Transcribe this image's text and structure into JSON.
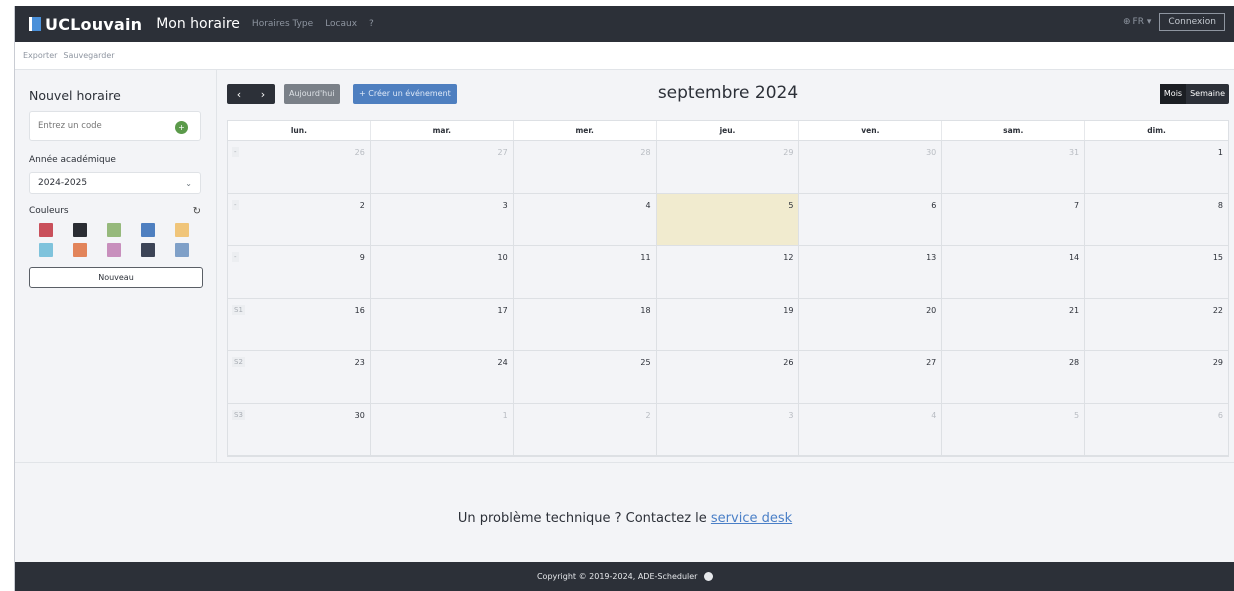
{
  "navbar": {
    "brand": "UCLouvain",
    "main_link": "Mon horaire",
    "links": [
      "Horaires Type",
      "Locaux",
      "?"
    ],
    "lang": "FR",
    "login_button": "Connexion"
  },
  "subbar": {
    "items": [
      "Exporter",
      "Sauvegarder"
    ]
  },
  "sidebar": {
    "title": "Nouvel horaire",
    "code_placeholder": "Entrez un code",
    "code_add_icon": "+",
    "year_label": "Année académique",
    "year_value": "2024-2025",
    "colors_label": "Couleurs",
    "colors": [
      "#c9505b",
      "#2a2d33",
      "#96b97c",
      "#4e7fc0",
      "#f0c57a",
      "#7fc3dc",
      "#e2845a",
      "#c88fbd",
      "#3c4456",
      "#7fa0c8"
    ],
    "new_button": "Nouveau"
  },
  "toolbar": {
    "prev_icon": "‹",
    "next_icon": "›",
    "today_button": "Aujourd'hui",
    "create_button": "+ Créer un événement",
    "month_title": "septembre 2024",
    "view_month": "Mois",
    "view_week": "Semaine"
  },
  "calendar": {
    "weekdays": [
      "lun.",
      "mar.",
      "mer.",
      "jeu.",
      "ven.",
      "sam.",
      "dim."
    ],
    "weeks": [
      {
        "week": "-",
        "days": [
          {
            "num": "26",
            "other": true
          },
          {
            "num": "27",
            "other": true
          },
          {
            "num": "28",
            "other": true
          },
          {
            "num": "29",
            "other": true
          },
          {
            "num": "30",
            "other": true
          },
          {
            "num": "31",
            "other": true
          },
          {
            "num": "1",
            "other": false
          }
        ]
      },
      {
        "week": "-",
        "days": [
          {
            "num": "2",
            "other": false
          },
          {
            "num": "3",
            "other": false
          },
          {
            "num": "4",
            "other": false
          },
          {
            "num": "5",
            "other": false,
            "today": true
          },
          {
            "num": "6",
            "other": false
          },
          {
            "num": "7",
            "other": false
          },
          {
            "num": "8",
            "other": false
          }
        ]
      },
      {
        "week": "-",
        "days": [
          {
            "num": "9",
            "other": false
          },
          {
            "num": "10",
            "other": false
          },
          {
            "num": "11",
            "other": false
          },
          {
            "num": "12",
            "other": false
          },
          {
            "num": "13",
            "other": false
          },
          {
            "num": "14",
            "other": false
          },
          {
            "num": "15",
            "other": false
          }
        ]
      },
      {
        "week": "S1",
        "days": [
          {
            "num": "16",
            "other": false
          },
          {
            "num": "17",
            "other": false
          },
          {
            "num": "18",
            "other": false
          },
          {
            "num": "19",
            "other": false
          },
          {
            "num": "20",
            "other": false
          },
          {
            "num": "21",
            "other": false
          },
          {
            "num": "22",
            "other": false
          }
        ]
      },
      {
        "week": "S2",
        "days": [
          {
            "num": "23",
            "other": false
          },
          {
            "num": "24",
            "other": false
          },
          {
            "num": "25",
            "other": false
          },
          {
            "num": "26",
            "other": false
          },
          {
            "num": "27",
            "other": false
          },
          {
            "num": "28",
            "other": false
          },
          {
            "num": "29",
            "other": false
          }
        ]
      },
      {
        "week": "S3",
        "days": [
          {
            "num": "30",
            "other": false
          },
          {
            "num": "1",
            "other": true
          },
          {
            "num": "2",
            "other": true
          },
          {
            "num": "3",
            "other": true
          },
          {
            "num": "4",
            "other": true
          },
          {
            "num": "5",
            "other": true
          },
          {
            "num": "6",
            "other": true
          }
        ]
      }
    ]
  },
  "help": {
    "text": "Un problème technique ? Contactez le",
    "link": "service desk"
  },
  "footer": {
    "text": "Copyright © 2019-2024, ADE-Scheduler"
  }
}
